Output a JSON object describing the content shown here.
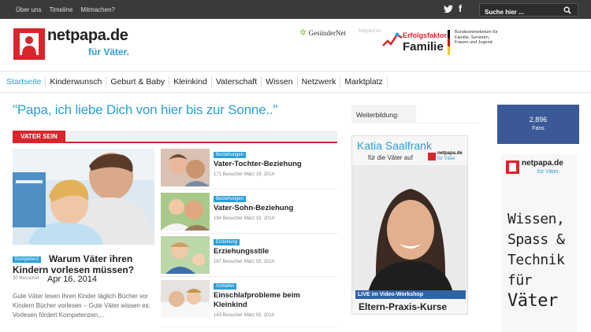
{
  "topbar": {
    "links": [
      "Über uns",
      "Timeline",
      "Mitmachen?"
    ],
    "search_placeholder": "Suche hier ...",
    "facebook_glyph": "f"
  },
  "header": {
    "logo_name": "netpapa.de",
    "logo_sub": "für Väter.",
    "partner1": "GesünderNet",
    "partner1_note": "Mitglied im",
    "erfolg_small": "Erfolgsfaktor",
    "erfolg_big": "Familie",
    "bund": "Bundesministerium für Familie, Senioren, Frauen und Jugend"
  },
  "nav": {
    "items": [
      "Startseite",
      "Kinderwunsch",
      "Geburt & Baby",
      "Kleinkind",
      "Vaterschaft",
      "Wissen",
      "Netzwerk",
      "Marktplatz"
    ],
    "active": "Startseite"
  },
  "quote": "\"Papa, ich liebe Dich von hier bis zur Sonne..\"",
  "category": "VATER SEIN",
  "main_article": {
    "badge": "Kompetenz",
    "title_line1": "Warum Väter ihren",
    "title_line2": "Kindern vorlesen müssen?",
    "visitors": "30 Besucher",
    "date": "Apr 16, 2014",
    "excerpt": "Gute Väter lesen Ihren Kinder täglich Bücher vor Kindern Bücher vorlesen – Gute Väter wissen es: Vorlesen fördert Kompetenzen,..."
  },
  "side_articles": [
    {
      "badge": "Beziehungen",
      "title": "Vater-Tochter-Beziehung",
      "meta": "172 Besucher   März 19, 2014"
    },
    {
      "badge": "Beziehungen",
      "title": "Vater-Sohn-Beziehung",
      "meta": "194 Besucher   März 19, 2014"
    },
    {
      "badge": "Erziehung",
      "title": "Erziehungsstile",
      "meta": "187 Besucher   März 03, 2014"
    },
    {
      "badge": "Schlafen",
      "title": "Einschlafprobleme beim Kleinkind",
      "meta": "143 Besucher   März 03, 2014"
    }
  ],
  "weiterbildung": {
    "label": "Weiterbildung:",
    "ad_name": "Katia Saalfrank",
    "ad_sub": "für die Väter auf",
    "mini_name": "netpapa.de",
    "mini_sub": "für Väter",
    "live": "LIVE im Video-Workshop",
    "kurse": "Eltern-Praxis-Kurse"
  },
  "fans": {
    "count": "2,896",
    "label": "Fans"
  },
  "right_ad": {
    "name": "netpapa.de",
    "sub": "für Väter.",
    "lines": [
      "Wissen,",
      "Spass &",
      "Technik",
      "für",
      "Väter"
    ]
  },
  "colors": {
    "accent_blue": "#2b9fd9",
    "accent_red": "#d8262c",
    "facebook": "#3b5998"
  }
}
